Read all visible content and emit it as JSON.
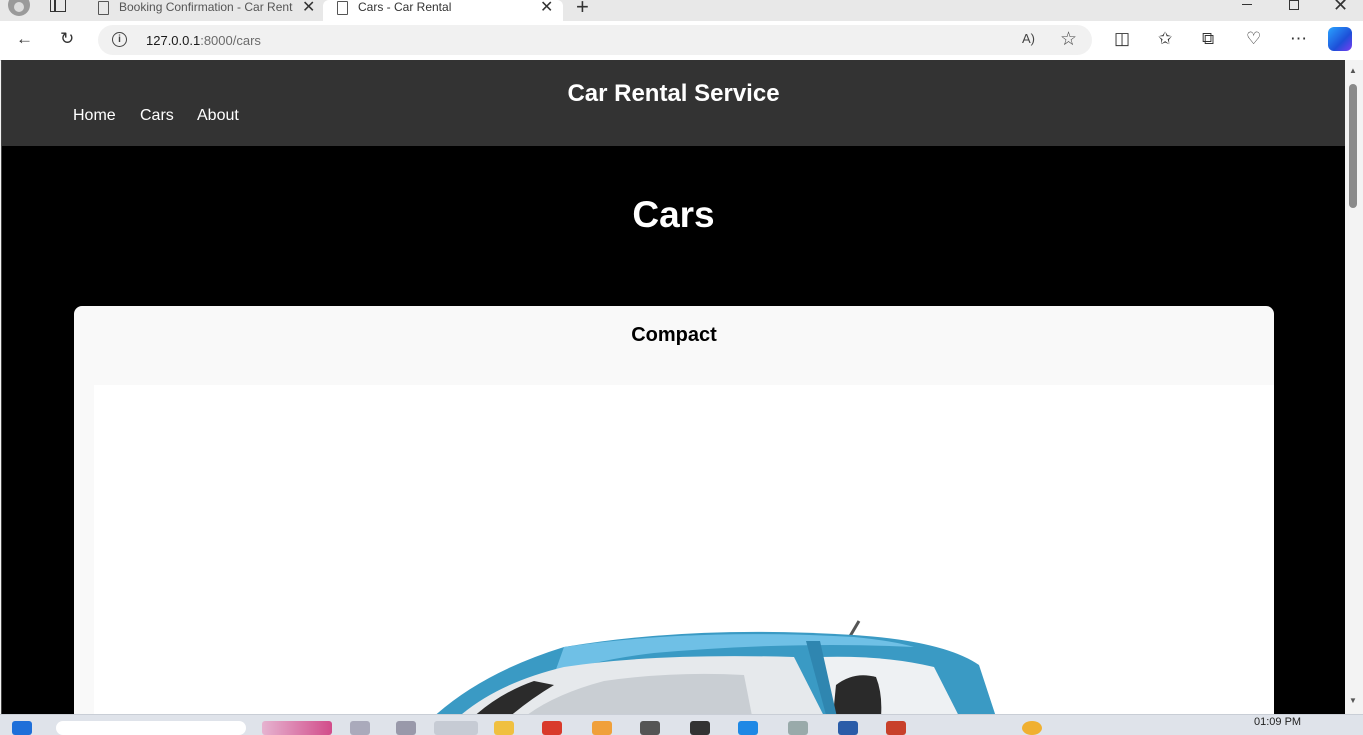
{
  "browser": {
    "tabs": [
      {
        "title": "Booking Confirmation - Car Rent",
        "active": false
      },
      {
        "title": "Cars - Car Rental",
        "active": true
      }
    ],
    "address": {
      "host": "127.0.0.1",
      "rest": ":8000/cars"
    }
  },
  "site": {
    "title": "Car Rental Service",
    "nav": [
      "Home",
      "Cars",
      "About"
    ]
  },
  "page": {
    "heading": "Cars",
    "cars": [
      {
        "name": "Compact",
        "color": "#3a9ac4"
      }
    ]
  },
  "taskbar": {
    "time": "01:09 PM"
  },
  "colors": {
    "header_bg": "#333333",
    "page_bg": "#000000",
    "card_bg": "#f9f9f9",
    "car_body": "#3a9ac4"
  }
}
